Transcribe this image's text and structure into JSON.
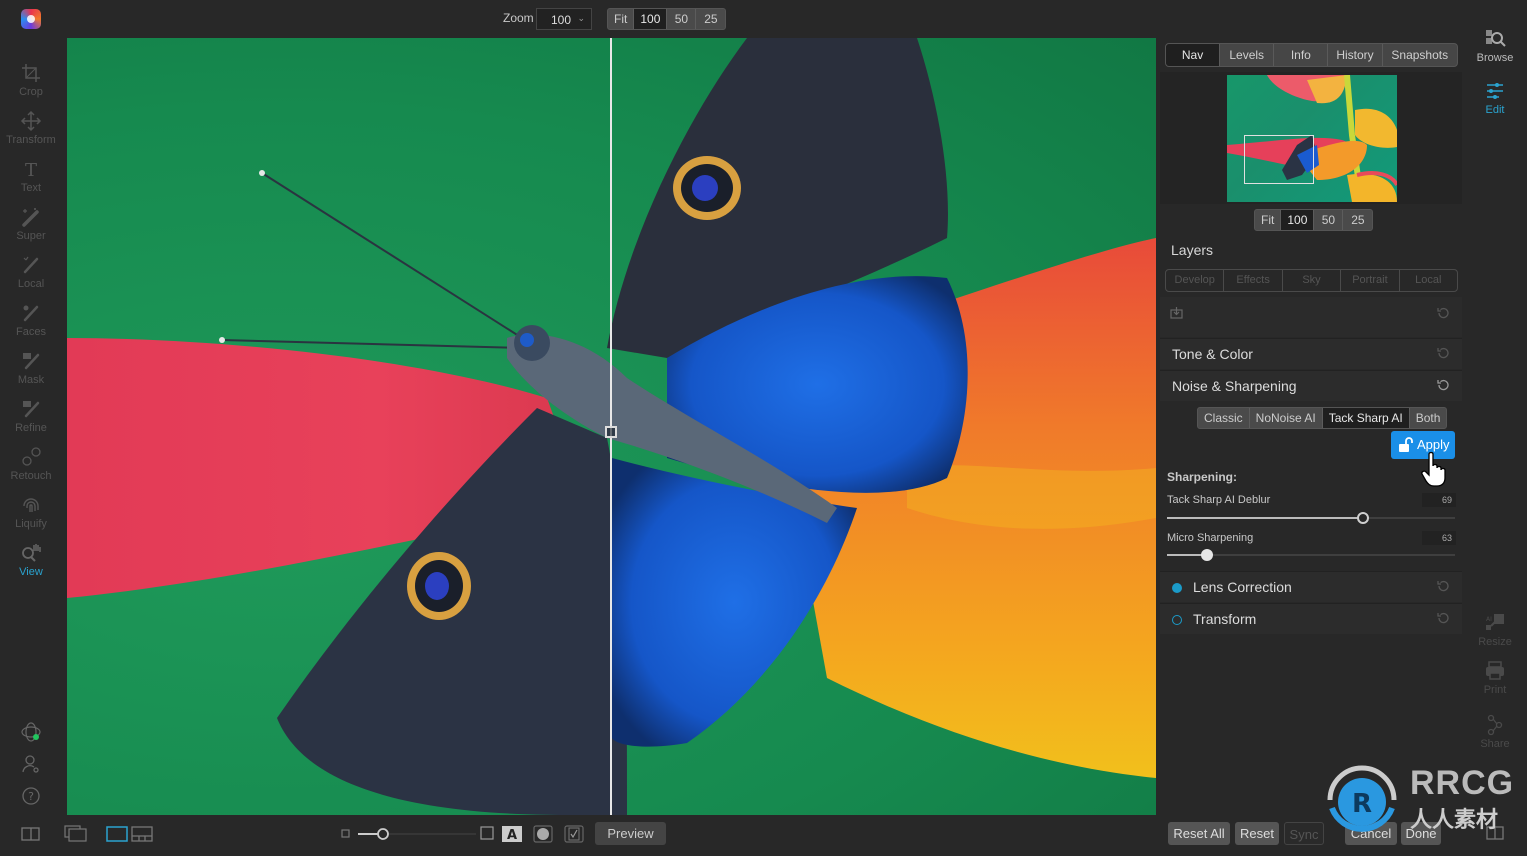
{
  "left_toolbar": {
    "tools": [
      {
        "id": "crop",
        "label": "Crop"
      },
      {
        "id": "transform",
        "label": "Transform"
      },
      {
        "id": "text",
        "label": "Text"
      },
      {
        "id": "super",
        "label": "Super"
      },
      {
        "id": "local",
        "label": "Local"
      },
      {
        "id": "faces",
        "label": "Faces"
      },
      {
        "id": "mask",
        "label": "Mask"
      },
      {
        "id": "refine",
        "label": "Refine"
      },
      {
        "id": "retouch",
        "label": "Retouch"
      },
      {
        "id": "liquify",
        "label": "Liquify"
      },
      {
        "id": "view",
        "label": "View",
        "active": true
      }
    ],
    "bottom_icons": [
      "extensions-icon",
      "account-icon",
      "help-icon"
    ]
  },
  "top_bar": {
    "zoom_label": "Zoom",
    "zoom_value": "100",
    "zoom_presets": [
      "Fit",
      "100",
      "50",
      "25"
    ],
    "zoom_selected": "100"
  },
  "right_panel": {
    "tabs": [
      "Nav",
      "Levels",
      "Info",
      "History",
      "Snapshots"
    ],
    "selected_tab": "Nav",
    "nav_zoom_presets": [
      "Fit",
      "100",
      "50",
      "25"
    ],
    "nav_zoom_selected": "100",
    "layers_title": "Layers",
    "layer_tabs": [
      "Develop",
      "Effects",
      "Sky",
      "Portrait",
      "Local"
    ],
    "sections": {
      "tone_color": "Tone & Color",
      "noise_sharpening": "Noise & Sharpening",
      "lens_correction": "Lens Correction",
      "transform": "Transform"
    },
    "noise_modes": [
      "Classic",
      "NoNoise AI",
      "Tack Sharp AI",
      "Both"
    ],
    "noise_mode_selected": "Tack Sharp AI",
    "apply_label": "Apply",
    "sharpening_label": "Sharpening:",
    "sliders": [
      {
        "label": "Tack Sharp AI Deblur",
        "value": "69",
        "fraction": 0.68
      },
      {
        "label": "Micro Sharpening",
        "value": "63",
        "fraction": 0.14
      }
    ],
    "lens_correction_enabled": true,
    "transform_enabled": false
  },
  "right_bar": {
    "items": [
      {
        "id": "browse",
        "label": "Browse"
      },
      {
        "id": "edit",
        "label": "Edit",
        "active": true
      },
      {
        "id": "resize",
        "label": "Resize"
      },
      {
        "id": "print",
        "label": "Print"
      },
      {
        "id": "share",
        "label": "Share"
      }
    ]
  },
  "bottom_bar": {
    "preview_label": "Preview",
    "buttons": {
      "reset_all": "Reset All",
      "reset": "Reset",
      "sync": "Sync",
      "cancel": "Cancel",
      "done": "Done"
    }
  },
  "watermark": {
    "text_top": "RRCG",
    "text_bottom": "人人素材"
  },
  "colors": {
    "accent": "#2aa3cf",
    "apply_button": "#1a8fe8",
    "background": "#282828"
  }
}
